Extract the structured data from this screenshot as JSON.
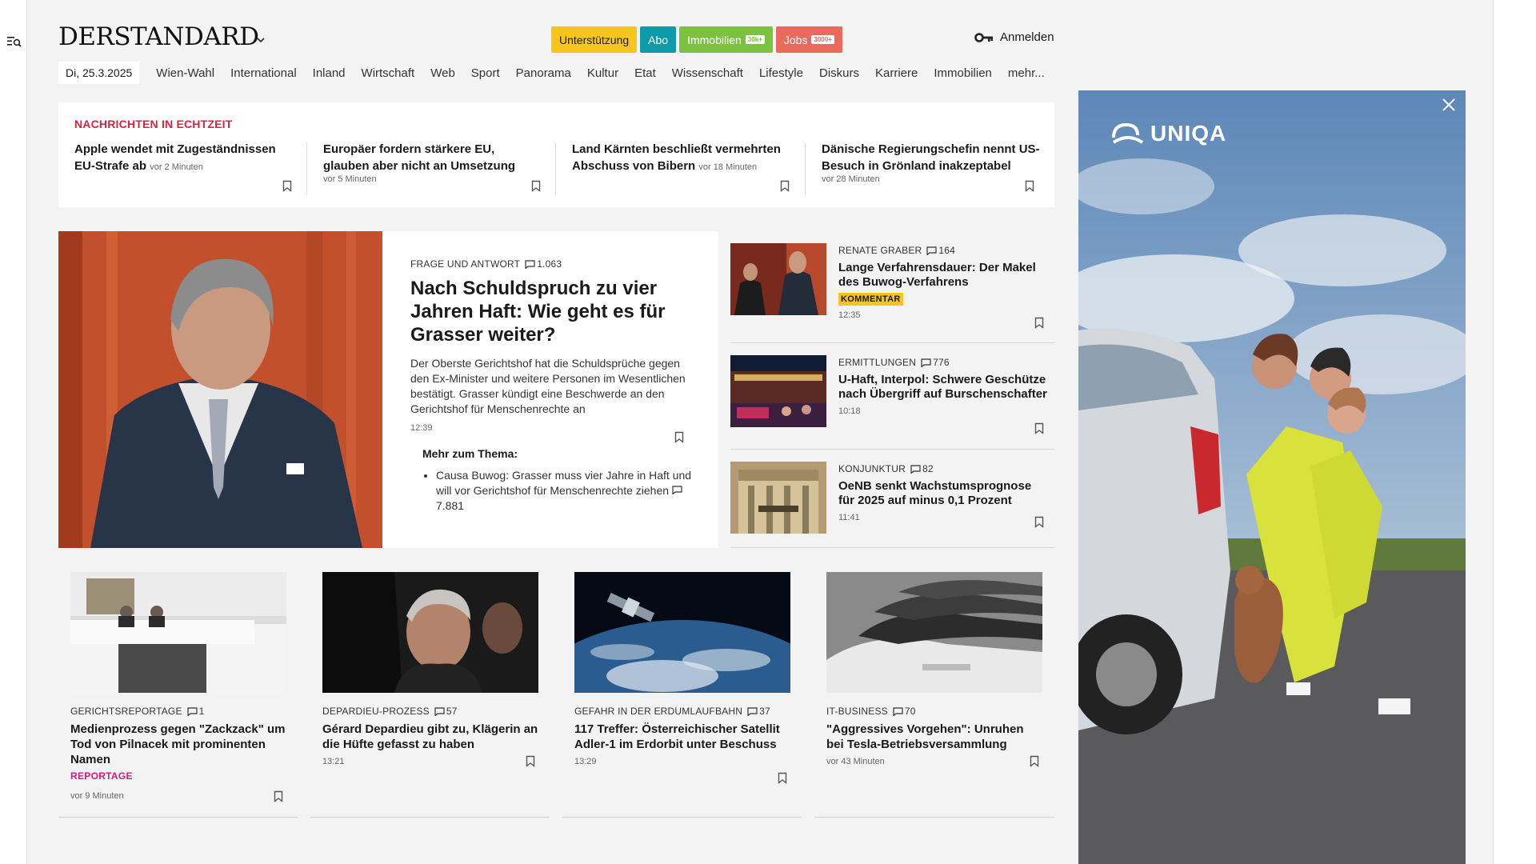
{
  "brand": {
    "logo": "DERSTANDARD"
  },
  "header": {
    "pills": [
      {
        "label": "Unterstützung"
      },
      {
        "label": "Abo"
      },
      {
        "label": "Immobilien",
        "tag": "30k+"
      },
      {
        "label": "Jobs",
        "tag": "3000+"
      }
    ],
    "login": "Anmelden"
  },
  "nav": {
    "date": "Di, 25.3.2025",
    "items": [
      "Wien-Wahl",
      "International",
      "Inland",
      "Wirtschaft",
      "Web",
      "Sport",
      "Panorama",
      "Kultur",
      "Etat",
      "Wissenschaft",
      "Lifestyle",
      "Diskurs",
      "Karriere",
      "Immobilien",
      "mehr..."
    ]
  },
  "ticker": {
    "title": "NACHRICHTEN IN ECHTZEIT",
    "items": [
      {
        "title": "Apple wendet mit Zugeständnissen EU-Strafe ab",
        "ago": "vor 2 Minuten"
      },
      {
        "title": "Europäer fordern stärkere EU, glauben aber nicht an Umsetzung",
        "ago": "vor 5 Minuten"
      },
      {
        "title": "Land Kärnten beschließt vermehrten Abschuss von Bibern",
        "ago": "vor 18 Minuten"
      },
      {
        "title": "Dänische Regierungschefin nennt US-Besuch in Grönland inakzeptabel",
        "ago": "vor 28 Minuten"
      }
    ]
  },
  "lead": {
    "kicker": "FRAGE UND ANTWORT",
    "comments": "1.063",
    "title": "Nach Schuldspruch zu vier Jahren Haft: Wie geht es für Grasser weiter?",
    "teaser": "Der Oberste Gerichtshof hat die Schuldsprüche gegen den Ex-Minister und weitere Personen im Wesentlichen bestätigt. Grasser kündigt eine Beschwerde an den Gerichtshof für Menschenrechte an",
    "time": "12:39",
    "more_title": "Mehr zum Thema:",
    "more_item": "Causa Buwog: Grasser muss vier Jahre in Haft und will vor Gerichtshof für Menschenrechte ziehen",
    "more_comments": "7.881"
  },
  "side": [
    {
      "kicker": "RENATE GRABER",
      "comments": "164",
      "title": "Lange Verfahrensdauer: Der Makel des Buwog-Verfahrens",
      "badge": "KOMMENTAR",
      "time": "12:35"
    },
    {
      "kicker": "ERMITTLUNGEN",
      "comments": "776",
      "title": "U-Haft, Interpol: Schwere Geschütze nach Übergriff auf Burschenschafter",
      "time": "10:18"
    },
    {
      "kicker": "KONJUNKTUR",
      "comments": "82",
      "title": "OeNB senkt Wachstumsprognose für 2025 auf minus 0,1 Prozent",
      "time": "11:41"
    }
  ],
  "cards": [
    {
      "kicker": "GERICHTSREPORTAGE",
      "comments": "1",
      "title": "Medienprozess gegen \"Zackzack\" um Tod von Pilnacek mit prominenten Namen",
      "badge": "REPORTAGE",
      "time": "vor 9 Minuten"
    },
    {
      "kicker": "DEPARDIEU-PROZESS",
      "comments": "57",
      "title": "Gérard Depardieu gibt zu, Klägerin an die Hüfte gefasst zu haben",
      "time": "13:21"
    },
    {
      "kicker": "GEFAHR IN DER ERDUMLAUFBAHN",
      "comments": "37",
      "title": "117 Treffer: Österreichischer Satellit Adler-1 im Erdorbit unter Beschuss",
      "time": "13:29"
    },
    {
      "kicker": "IT-BUSINESS",
      "comments": "70",
      "title": "\"Aggressives Vorgehen\": Unruhen bei Tesla-Betriebsversammlung",
      "time": "vor 43 Minuten"
    }
  ],
  "ad": {
    "brand": "UNIQA"
  },
  "icons": {
    "menu": "menu-search-icon",
    "key": "key-icon",
    "bookmark": "bookmark-icon",
    "comment": "comment-icon",
    "close": "close-icon"
  },
  "colors": {
    "accent_red": "#e0203f",
    "support": "#f7c51c",
    "abo": "#0f9aa8",
    "immo": "#7cc23f",
    "jobs": "#ea6b5e",
    "reportage": "#d6197f"
  }
}
